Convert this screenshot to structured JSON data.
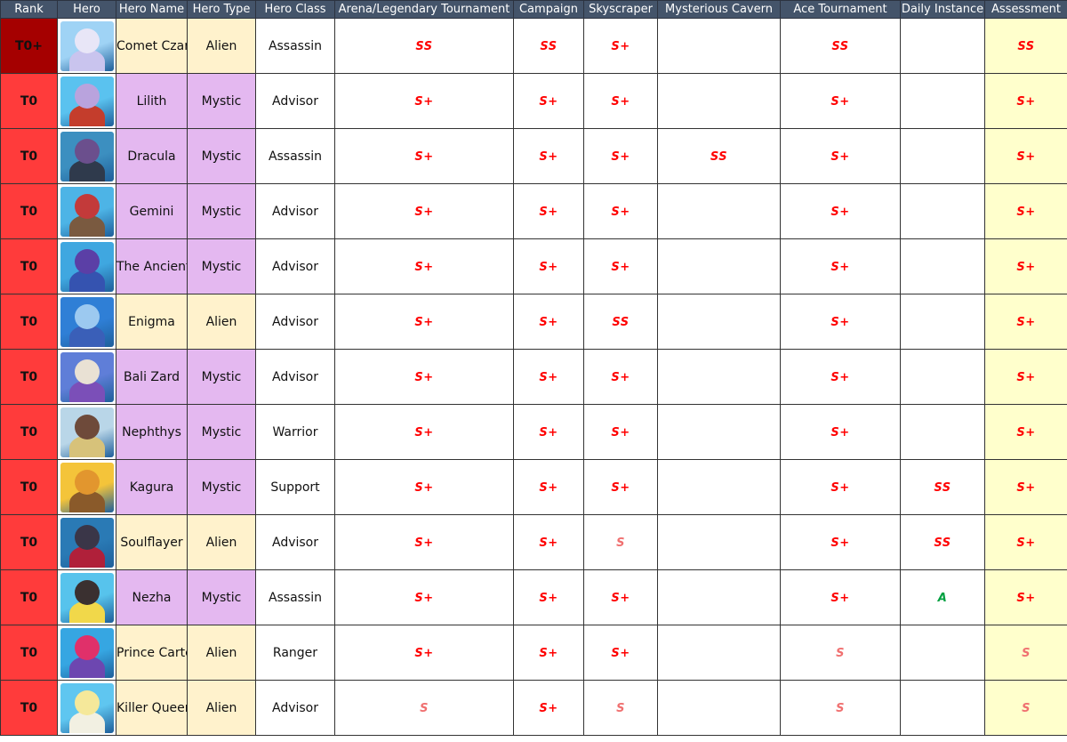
{
  "headers": [
    "Rank",
    "Hero",
    "Hero Name",
    "Hero Type",
    "Hero Class",
    "Arena/Legendary Tournament",
    "Campaign",
    "Skyscraper",
    "Mysterious Cavern",
    "Ace Tournament",
    "Daily Instance",
    "Assessment"
  ],
  "colors": {
    "header_bg": "#44546a",
    "rank_t0plus": "#a50000",
    "rank_t0": "#ff3b3b",
    "alien_bg": "#fff2cc",
    "mystic_bg": "#e4b8f0",
    "assessment_bg": "#ffffcc",
    "grade_strong": "#ff0000",
    "grade_s": "#f07070",
    "grade_a": "#00a040"
  },
  "rows": [
    {
      "rank": "T0+",
      "portrait": "comet-czar-portrait",
      "name": "Comet Czar",
      "type": "Alien",
      "class": "Assassin",
      "arena": "SS",
      "campaign": "SS",
      "skyscraper": "S+",
      "cavern": "",
      "ace": "SS",
      "daily": "",
      "assessment": "SS"
    },
    {
      "rank": "T0",
      "portrait": "lilith-portrait",
      "name": "Lilith",
      "type": "Mystic",
      "class": "Advisor",
      "arena": "S+",
      "campaign": "S+",
      "skyscraper": "S+",
      "cavern": "",
      "ace": "S+",
      "daily": "",
      "assessment": "S+"
    },
    {
      "rank": "T0",
      "portrait": "dracula-portrait",
      "name": "Dracula",
      "type": "Mystic",
      "class": "Assassin",
      "arena": "S+",
      "campaign": "S+",
      "skyscraper": "S+",
      "cavern": "SS",
      "ace": "S+",
      "daily": "",
      "assessment": "S+"
    },
    {
      "rank": "T0",
      "portrait": "gemini-portrait",
      "name": "Gemini",
      "type": "Mystic",
      "class": "Advisor",
      "arena": "S+",
      "campaign": "S+",
      "skyscraper": "S+",
      "cavern": "",
      "ace": "S+",
      "daily": "",
      "assessment": "S+"
    },
    {
      "rank": "T0",
      "portrait": "the-ancient-portrait",
      "name": "The Ancient",
      "type": "Mystic",
      "class": "Advisor",
      "arena": "S+",
      "campaign": "S+",
      "skyscraper": "S+",
      "cavern": "",
      "ace": "S+",
      "daily": "",
      "assessment": "S+"
    },
    {
      "rank": "T0",
      "portrait": "enigma-portrait",
      "name": "Enigma",
      "type": "Alien",
      "class": "Advisor",
      "arena": "S+",
      "campaign": "S+",
      "skyscraper": "SS",
      "cavern": "",
      "ace": "S+",
      "daily": "",
      "assessment": "S+"
    },
    {
      "rank": "T0",
      "portrait": "bali-zard-portrait",
      "name": "Bali Zard",
      "type": "Mystic",
      "class": "Advisor",
      "arena": "S+",
      "campaign": "S+",
      "skyscraper": "S+",
      "cavern": "",
      "ace": "S+",
      "daily": "",
      "assessment": "S+"
    },
    {
      "rank": "T0",
      "portrait": "nephthys-portrait",
      "name": "Nephthys",
      "type": "Mystic",
      "class": "Warrior",
      "arena": "S+",
      "campaign": "S+",
      "skyscraper": "S+",
      "cavern": "",
      "ace": "S+",
      "daily": "",
      "assessment": "S+"
    },
    {
      "rank": "T0",
      "portrait": "kagura-portrait",
      "name": "Kagura",
      "type": "Mystic",
      "class": "Support",
      "arena": "S+",
      "campaign": "S+",
      "skyscraper": "S+",
      "cavern": "",
      "ace": "S+",
      "daily": "SS",
      "assessment": "S+"
    },
    {
      "rank": "T0",
      "portrait": "soulflayer-portrait",
      "name": "Soulflayer",
      "type": "Alien",
      "class": "Advisor",
      "arena": "S+",
      "campaign": "S+",
      "skyscraper": "S",
      "cavern": "",
      "ace": "S+",
      "daily": "SS",
      "assessment": "S+"
    },
    {
      "rank": "T0",
      "portrait": "nezha-portrait",
      "name": "Nezha",
      "type": "Mystic",
      "class": "Assassin",
      "arena": "S+",
      "campaign": "S+",
      "skyscraper": "S+",
      "cavern": "",
      "ace": "S+",
      "daily": "A",
      "assessment": "S+"
    },
    {
      "rank": "T0",
      "portrait": "prince-carter-portrait",
      "name": "Prince Carter",
      "type": "Alien",
      "class": "Ranger",
      "arena": "S+",
      "campaign": "S+",
      "skyscraper": "S+",
      "cavern": "",
      "ace": "S",
      "daily": "",
      "assessment": "S"
    },
    {
      "rank": "T0",
      "portrait": "killer-queen-portrait",
      "name": "Killer Queen",
      "type": "Alien",
      "class": "Advisor",
      "arena": "S",
      "campaign": "S+",
      "skyscraper": "S",
      "cavern": "",
      "ace": "S",
      "daily": "",
      "assessment": "S"
    }
  ]
}
